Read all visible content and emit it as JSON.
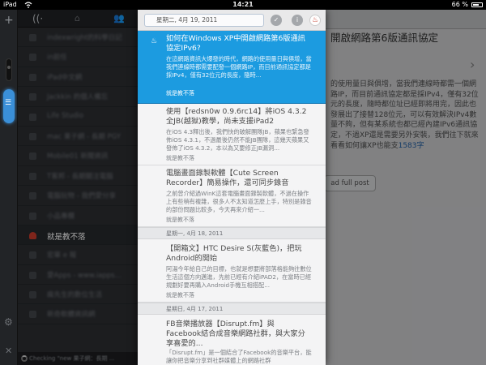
{
  "status_bar": {
    "carrier": "iPad",
    "time": "14:21",
    "battery": "66 %"
  },
  "feeds_panel": {
    "checking_text": "Checking \"new 果子網：長期 ...",
    "items": [
      {
        "label": "indexwright的科學日記",
        "icon": "feed-icon"
      },
      {
        "label": "in前任",
        "icon": "feed-icon"
      },
      {
        "label": "iPad中文網",
        "icon": "feed-icon"
      },
      {
        "label": "Jackkin 的個人備忘",
        "icon": "feed-icon"
      },
      {
        "label": "Life Studio",
        "icon": "feed-icon"
      },
      {
        "label": "mac 果子網 - 長期 PGY",
        "icon": "feed-icon"
      },
      {
        "label": "Mobile01 新聞資訊",
        "icon": "feed-icon"
      },
      {
        "label": "T客邦 - 長期關注電腦",
        "icon": "feed-icon"
      },
      {
        "label": "電腦玩物 - 我們愛分享",
        "icon": "feed-icon"
      },
      {
        "label": "小品專欄",
        "icon": "feed-icon"
      },
      {
        "label": "就是教不落",
        "icon": "site-logo-icon",
        "active": true
      },
      {
        "label": "宏華 e 報",
        "icon": "feed-icon"
      },
      {
        "label": "愛Apps - www.iapps...",
        "icon": "feed-icon"
      },
      {
        "label": "瘋先生的數位生活",
        "icon": "feed-icon"
      },
      {
        "label": "新奇軟體資訊網",
        "icon": "feed-icon"
      }
    ]
  },
  "list_header": {
    "date": "星期二, 4月 19, 2011"
  },
  "posts": [
    {
      "title": "如何在Windows XP中開啟網路第6版通訊協定IPv6?",
      "summary": "在這網路資訊大爆發的時代，網路的使用量日與俱增，當我們連線時都需要配發一個網路IP，而目前通訊協定都是採IPv4，僅有32位元的長度，隨時...",
      "source": "就是教不落",
      "selected": true
    },
    {
      "title": "使用【redsn0w 0.9.6rc14】將iOS 4.3.2全JB(越獄)教學，尚未支援iPad2",
      "summary": "在iOS 4.3釋出後，我們快的破解團隊JB，蘋果也緊急發佈iOS 4.3.1，不過最後仍然不能JB團隊，這幾天蘋果又發佈了iOS 4.3.2，本以為又要修正JB漏洞...",
      "source": "就是教不落"
    },
    {
      "title": "電腦畫面錄製軟體【Cute Screen Recorder】簡易操作，還可同步錄音",
      "summary": "之前曾介紹過WinK這套電腦畫面錄製軟體，不過在操作上有些稍有複雜，很多人不太知道怎麼上手，特別是錄音的部份問題比較多，今天再來介紹一...",
      "source": "就是教不落"
    },
    {
      "title": "【開箱文】HTC Desire S(灰藍色)，把玩Android的開始",
      "summary": "阿湯今年給自己的目標，也就是想要將部落格能夠往數位生活這個方向邁進，先前已經有介紹iPAD2，在當時已經規劃好要再購入Android手機互相搭配...",
      "source": "就是教不落"
    },
    {
      "title": "FB音樂播放器【Disrupt.fm】與Facebook結合成音樂網路社群，與大家分享喜愛的...",
      "summary": "「Disrupt.fm」是一個結合了Facebook的音樂平台，能讓你把音樂分享到社群媒體上的網路社群「Facebook」，或是讓音樂人透過 Facebook...",
      "source": ""
    }
  ],
  "separators": [
    "星期一, 4月 18, 2011",
    "星期日, 4月 17, 2011"
  ],
  "article": {
    "title": "開啟網路第6版通訊協定",
    "body": "的使用量日與俱增，當我們連線時都需一個網路IP，而目前通訊協定都是採IPv4，僅有32位元的長度，隨時都位址已經即將用完，因此也發展出了接替128位元，可以有效解決IPv4數量不夠，但有某系統也都已經內建IPv6通訊協定，不過XP還是需要另外安裝，我們往下就來看看如何讓XP也能支",
    "link": "1583字",
    "read_full_label": "ad full post"
  },
  "colors": {
    "selected": "#1c9be0",
    "rail_active": "#3a8fd8",
    "site_red": "#c43a2a"
  }
}
